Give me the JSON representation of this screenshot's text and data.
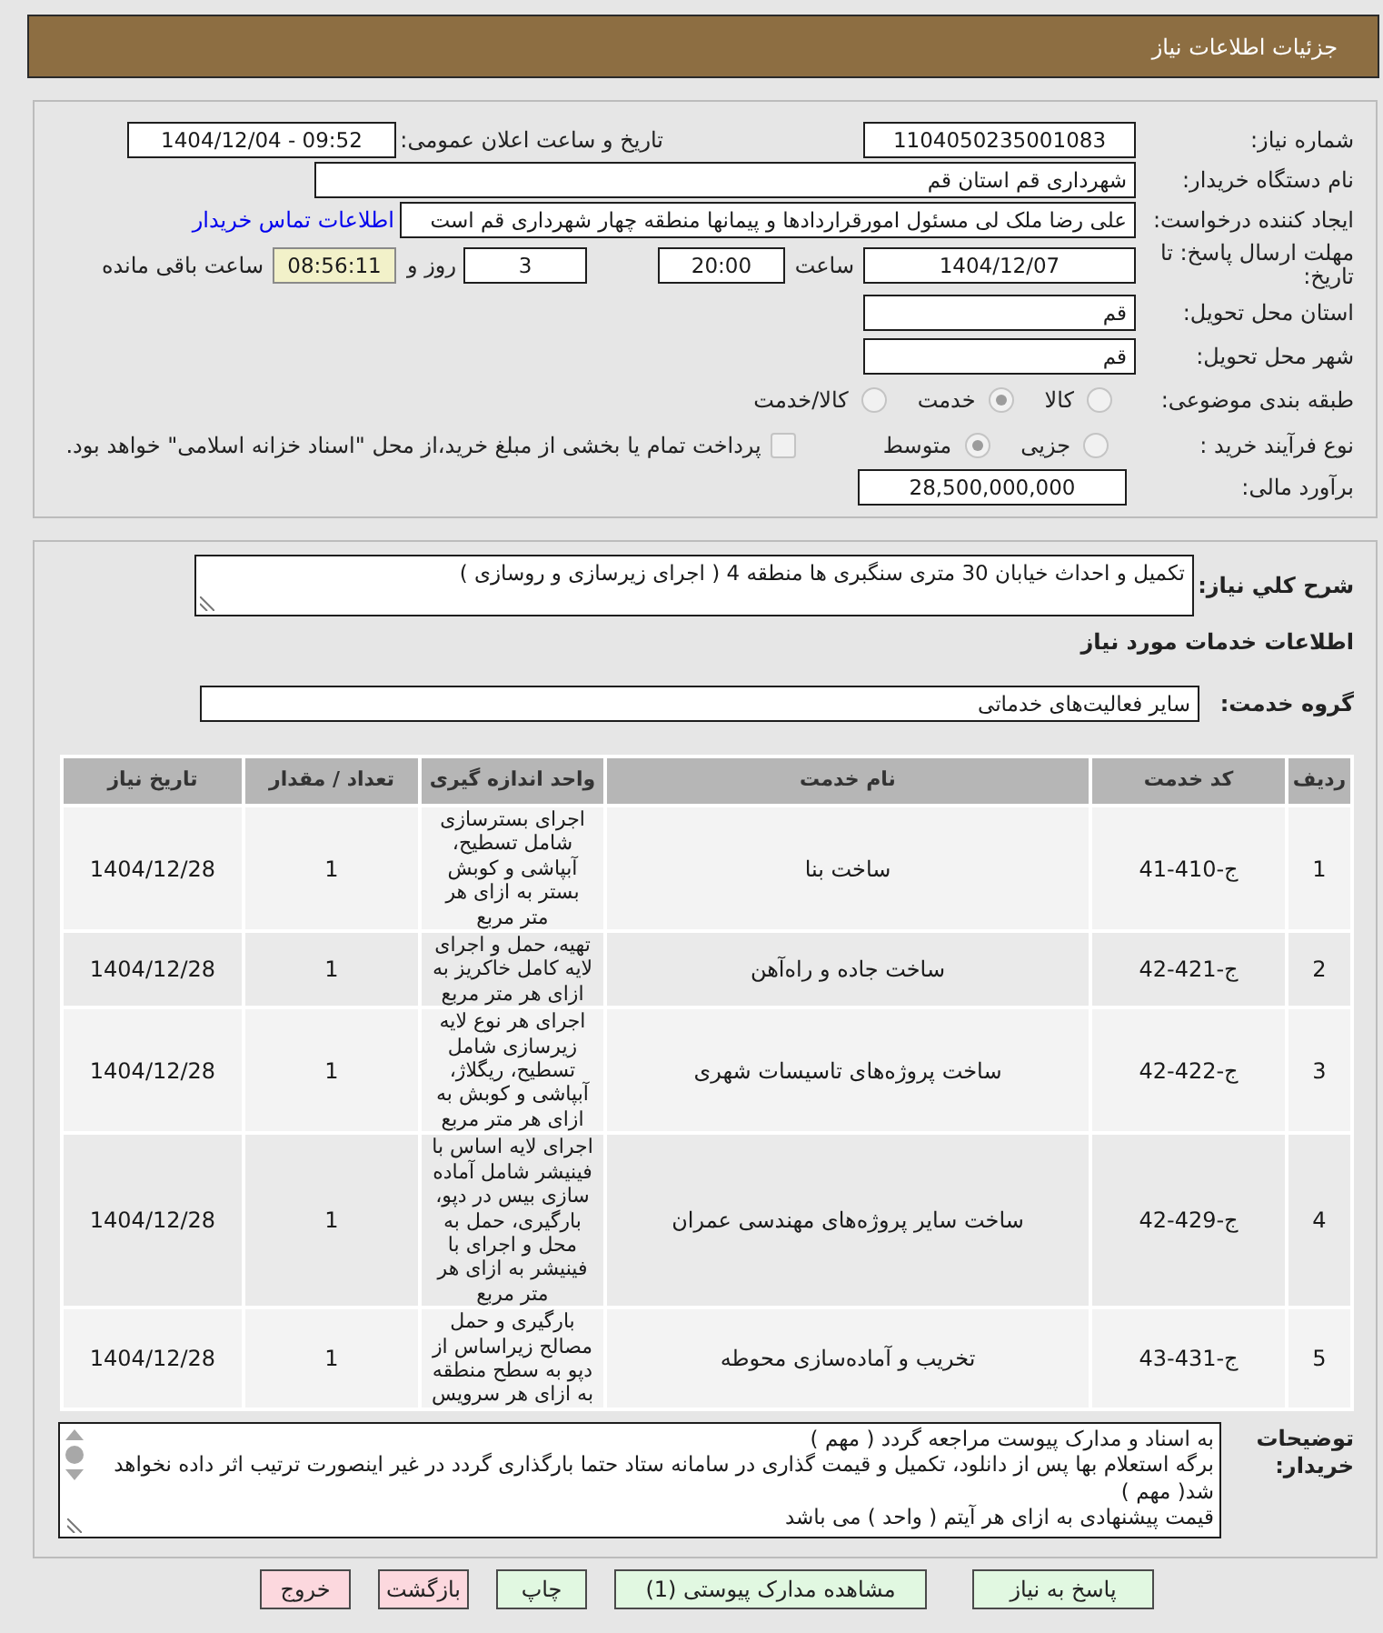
{
  "header": {
    "title": "جزئیات اطلاعات نیاز"
  },
  "details": {
    "need_number": {
      "label": "شماره نیاز:",
      "value": "1104050235001083"
    },
    "announce_date": {
      "label": "تاریخ و ساعت اعلان عمومی:",
      "value": "1404/12/04 - 09:52"
    },
    "buyer_org": {
      "label": "نام دستگاه خریدار:",
      "value": "شهرداری قم استان قم"
    },
    "requester": {
      "label": "ایجاد کننده درخواست:",
      "value": "علی رضا ملک لی مسئول امورقراردادها و پیمانها منطقه چهار شهرداری قم است",
      "contact_link": "اطلاعات تماس خریدار"
    },
    "deadline": {
      "label": "مهلت ارسال پاسخ: تا تاریخ:",
      "date": "1404/12/07",
      "time_label": "ساعت",
      "time": "20:00",
      "days": "3",
      "days_label": "روز و",
      "remaining": "08:56:11",
      "remaining_label": "ساعت باقی مانده"
    },
    "delivery_province": {
      "label": "استان محل تحویل:",
      "value": "قم"
    },
    "delivery_city": {
      "label": "شهر محل تحویل:",
      "value": "قم"
    },
    "subject_category": {
      "label": "طبقه بندی موضوعی:",
      "options": [
        {
          "label": "کالا",
          "selected": false
        },
        {
          "label": "خدمت",
          "selected": true
        },
        {
          "label": "کالا/خدمت",
          "selected": false
        }
      ]
    },
    "purchase_process": {
      "label": "نوع فرآیند خرید :",
      "options": [
        {
          "label": "جزیی",
          "selected": false
        },
        {
          "label": "متوسط",
          "selected": true
        }
      ],
      "treasury_payment": {
        "label": "پرداخت تمام یا بخشی از مبلغ خرید،از محل \"اسناد خزانه اسلامی\" خواهد بود.",
        "checked": false
      }
    },
    "budget": {
      "label": "برآورد مالی:",
      "value": "28,500,000,000"
    }
  },
  "need": {
    "summary": {
      "label": "شرح کلي نیاز:",
      "value": "تکمیل و احداث خیابان 30 متری سنگبری ها منطقه 4 ( اجرای زیرسازی و روسازی )"
    },
    "section_title": "اطلاعات خدمات مورد نیاز",
    "service_group": {
      "label": "گروه خدمت:",
      "value": "سایر فعالیت‌های خدماتی"
    },
    "table": {
      "columns": [
        "ردیف",
        "کد خدمت",
        "نام خدمت",
        "واحد اندازه گیری",
        "تعداد / مقدار",
        "تاریخ نیاز"
      ],
      "rows": [
        {
          "cells": [
            "1",
            "ج-410-41",
            "ساخت بنا",
            "اجرای بسترسازی شامل تسطیح، آبپاشی و کوبش بستر به ازای هر متر مربع",
            "1",
            "1404/12/28"
          ]
        },
        {
          "cells": [
            "2",
            "ج-421-42",
            "ساخت جاده و راه‌آهن",
            "تهیه، حمل و اجرای لایه کامل خاکریز به ازای هر متر مربع",
            "1",
            "1404/12/28"
          ]
        },
        {
          "cells": [
            "3",
            "ج-422-42",
            "ساخت پروژه‌های تاسیسات شهری",
            "اجرای هر نوع لایه زیرسازی شامل تسطیح، ریگلاژ، آبپاشی و کوبش به ازای هر متر مربع",
            "1",
            "1404/12/28"
          ]
        },
        {
          "cells": [
            "4",
            "ج-429-42",
            "ساخت سایر پروژه‌های مهندسی عمران",
            "اجرای لایه اساس با فینیشر شامل آماده سازی بیس در دپو، بارگیری، حمل به محل و اجرای با فینیشر به ازای هر متر مربع",
            "1",
            "1404/12/28"
          ]
        },
        {
          "cells": [
            "5",
            "ج-431-43",
            "تخریب و آماده‌سازی محوطه",
            "بارگیری و حمل مصالح زیراساس از دپو به سطح منطقه به ازای هر سرویس",
            "1",
            "1404/12/28"
          ]
        }
      ]
    }
  },
  "buyer_notes": {
    "label": "توضیحات خریدار:",
    "lines": [
      "به اسناد و مدارک پیوست مراجعه گردد ( مهم )",
      "برگه استعلام بها پس از دانلود، تکمیل و قیمت گذاری در سامانه ستاد حتما بارگذاری گردد در غیر اینصورت ترتیب اثر داده نخواهد شد( مهم )",
      "قیمت پیشنهادی به ازای هر آیتم ( واحد ) می باشد"
    ]
  },
  "buttons": [
    {
      "label": "پاسخ به نیاز",
      "kind": "confirm"
    },
    {
      "label": "مشاهده مدارک پیوستی (1)",
      "kind": "confirm"
    },
    {
      "label": "چاپ",
      "kind": "confirm"
    },
    {
      "label": "بازگشت",
      "kind": "cancel"
    },
    {
      "label": "خروج",
      "kind": "cancel"
    }
  ]
}
